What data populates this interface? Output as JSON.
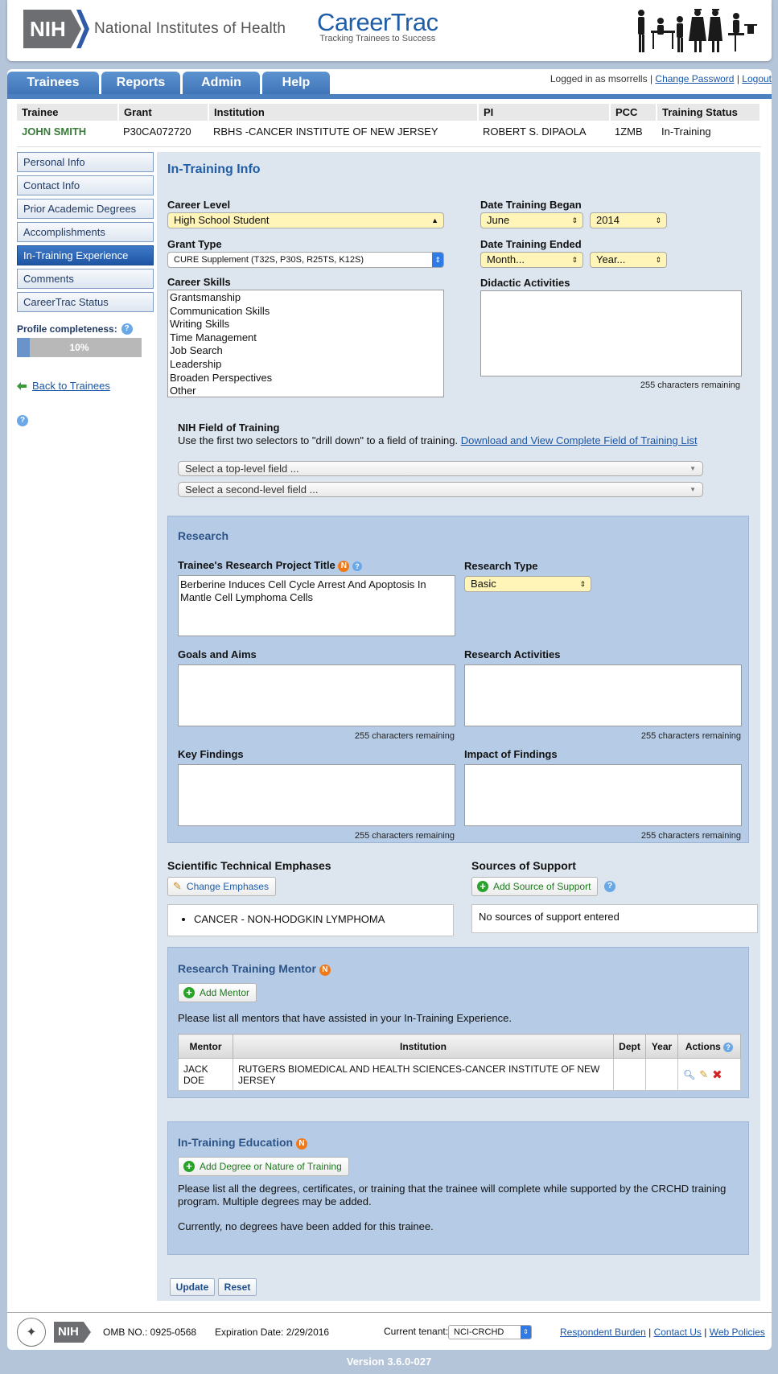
{
  "header": {
    "nih_abbr": "NIH",
    "nih_name": "National Institutes of Health",
    "app_name": "CareerTrac",
    "app_tagline": "Tracking Trainees to Success"
  },
  "tabs": [
    "Trainees",
    "Reports",
    "Admin",
    "Help"
  ],
  "login": {
    "logged_in_text": "Logged in as msorrells",
    "change_password": "Change Password",
    "logout": "Logout",
    "sep": "|"
  },
  "trainee": {
    "headers": [
      "Trainee",
      "Grant",
      "Institution",
      "PI",
      "PCC",
      "Training Status"
    ],
    "name": "JOHN SMITH",
    "grant": "P30CA072720",
    "institution": "RBHS -CANCER INSTITUTE OF NEW JERSEY",
    "pi": "ROBERT S. DIPAOLA",
    "pcc": "1ZMB",
    "status": "In-Training"
  },
  "sidebar": {
    "items": [
      "Personal Info",
      "Contact Info",
      "Prior Academic Degrees",
      "Accomplishments",
      "In-Training Experience",
      "Comments",
      "CareerTrac Status"
    ],
    "completeness_label": "Profile completeness:",
    "completeness_value": 0.1,
    "completeness_text": "10%",
    "back_link": "Back to Trainees",
    "help": "?"
  },
  "content": {
    "title": "In-Training Info",
    "career_level_label": "Career Level",
    "career_level_value": "High School Student",
    "grant_type_label": "Grant Type",
    "grant_type_value": "CURE Supplement (T32S, P30S, R25TS, K12S)",
    "career_skills_label": "Career Skills",
    "career_skills": [
      "Grantsmanship",
      "Communication Skills",
      "Writing Skills",
      "Time Management",
      "Job Search",
      "Leadership",
      "Broaden Perspectives",
      "Other"
    ],
    "date_began_label": "Date Training Began",
    "date_began_month": "June",
    "date_began_year": "2014",
    "date_ended_label": "Date Training Ended",
    "date_ended_month": "Month...",
    "date_ended_year": "Year...",
    "didactic_label": "Didactic Activities",
    "chars_remaining": "255 characters remaining",
    "field_title": "NIH Field of Training",
    "field_desc": "Use the first two selectors to \"drill down\" to a field of training.",
    "field_link": "Download and View Complete Field of Training List",
    "top_level_placeholder": "Select a top-level field ...",
    "second_level_placeholder": "Select a second-level field ..."
  },
  "research": {
    "title": "Research",
    "project_title_label": "Trainee's Research Project Title",
    "project_title_value": "Berberine Induces Cell Cycle Arrest And Apoptosis In Mantle Cell Lymphoma Cells",
    "research_type_label": "Research Type",
    "research_type_value": "Basic",
    "goals_label": "Goals and Aims",
    "activities_label": "Research Activities",
    "key_findings_label": "Key Findings",
    "impact_label": "Impact of Findings",
    "n_badge": "N"
  },
  "emphases": {
    "title": "Scientific Technical Emphases",
    "button": "Change Emphases",
    "items": [
      "CANCER - NON-HODGKIN LYMPHOMA"
    ]
  },
  "support": {
    "title": "Sources of Support",
    "button": "Add Source of Support",
    "empty": "No sources of support entered"
  },
  "mentor": {
    "title": "Research Training Mentor",
    "button": "Add Mentor",
    "desc": "Please list all mentors that have assisted in your In-Training Experience.",
    "headers": [
      "Mentor",
      "Institution",
      "Dept",
      "Year",
      "Actions"
    ],
    "rows": [
      {
        "mentor": "JACK DOE",
        "institution": "RUTGERS BIOMEDICAL AND HEALTH SCIENCES-CANCER INSTITUTE OF NEW JERSEY",
        "dept": "",
        "year": ""
      }
    ]
  },
  "education": {
    "title": "In-Training Education",
    "button": "Add Degree or Nature of Training",
    "desc": "Please list all the degrees, certificates, or training that the trainee will complete while supported by the CRCHD training program. Multiple degrees may be added.",
    "empty": "Currently, no degrees have been added for this trainee."
  },
  "form_buttons": {
    "update": "Update",
    "reset": "Reset"
  },
  "footer": {
    "omb": "OMB NO.: 0925-0568",
    "expiration": "Expiration Date: 2/29/2016",
    "tenant_label": "Current tenant:",
    "tenant_value": "NCI-CRCHD",
    "links": [
      "Respondent Burden",
      "Contact Us",
      "Web Policies"
    ],
    "nih_abbr": "NIH"
  },
  "version": "Version 3.6.0-027",
  "icons": {
    "help": "help-icon",
    "new_badge": "n-badge-icon",
    "back": "arrow-left-icon",
    "plus": "plus-icon",
    "pencil": "pencil-icon",
    "view": "magnifier-icon",
    "edit": "edit-icon",
    "delete": "delete-icon"
  },
  "colors": {
    "brand_blue": "#1f5da8",
    "tab_blue": "#4a7fc0",
    "trainee_green": "#3a7d3a",
    "panel_bg": "#dde5ee",
    "box_bg": "#b6cce6",
    "select_yellow": "#fff5b8"
  }
}
